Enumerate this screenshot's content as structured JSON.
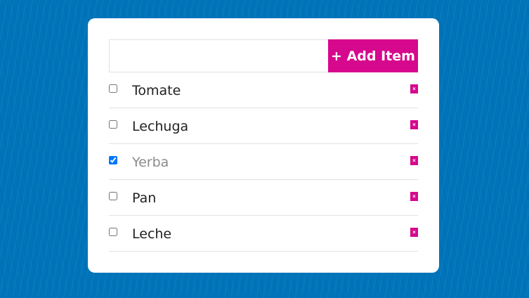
{
  "form": {
    "input_value": "",
    "add_button_label": "+ Add Item"
  },
  "items": [
    {
      "label": "Tomate",
      "checked": false,
      "delete_glyph": "×"
    },
    {
      "label": "Lechuga",
      "checked": false,
      "delete_glyph": "×"
    },
    {
      "label": "Yerba",
      "checked": true,
      "delete_glyph": "×"
    },
    {
      "label": "Pan",
      "checked": false,
      "delete_glyph": "×"
    },
    {
      "label": "Leche",
      "checked": false,
      "delete_glyph": "×"
    }
  ],
  "colors": {
    "background": "#0074ba",
    "accent": "#d6088d",
    "card": "#ffffff",
    "done_text": "#8c8c8c"
  },
  "icons": {
    "delete": "close-icon"
  }
}
